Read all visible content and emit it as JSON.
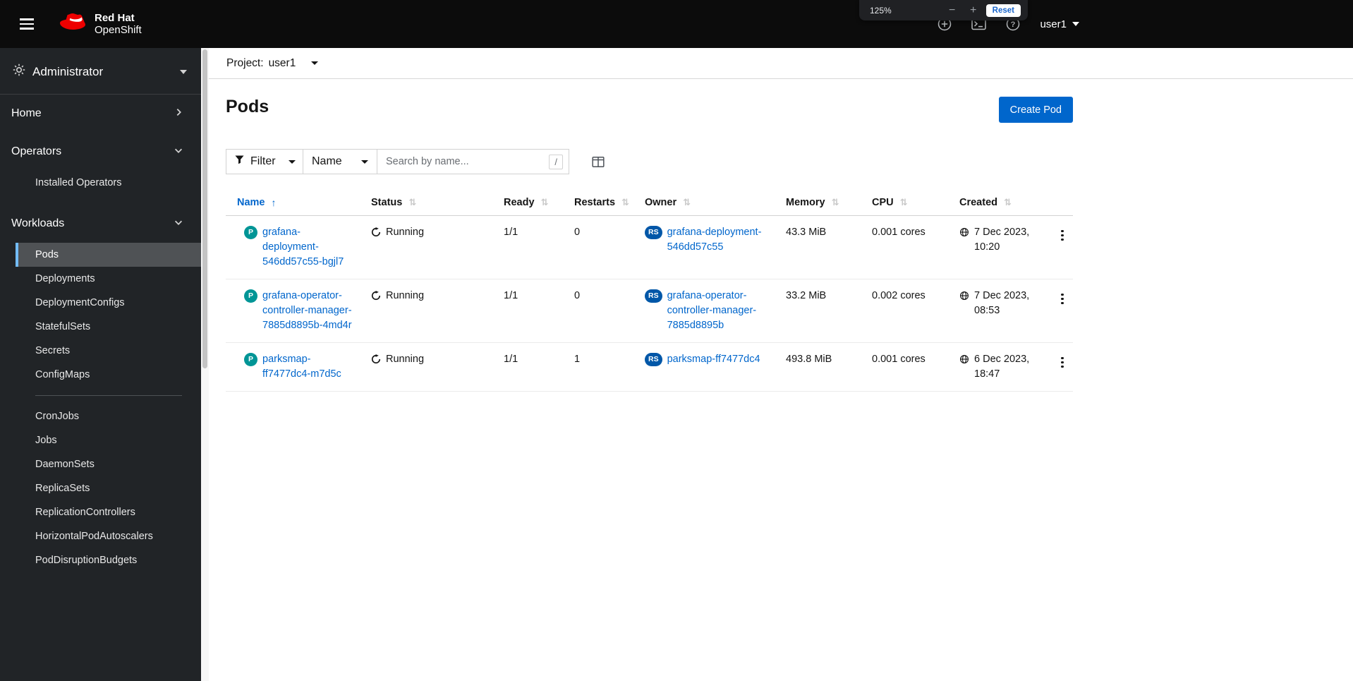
{
  "masthead": {
    "brand_line1": "Red Hat",
    "brand_line2": "OpenShift",
    "user": "user1",
    "zoom": {
      "level": "125%",
      "minus": "−",
      "plus": "+",
      "reset": "Reset"
    }
  },
  "sidebar": {
    "perspective": "Administrator",
    "sections": {
      "home": "Home",
      "operators": "Operators",
      "workloads": "Workloads"
    },
    "operators_items": [
      {
        "label": "Installed Operators"
      }
    ],
    "workloads_items": [
      {
        "label": "Pods",
        "state": "current"
      },
      {
        "label": "Deployments"
      },
      {
        "label": "DeploymentConfigs"
      },
      {
        "label": "StatefulSets"
      },
      {
        "label": "Secrets"
      },
      {
        "label": "ConfigMaps"
      },
      {
        "divider": true
      },
      {
        "label": "CronJobs"
      },
      {
        "label": "Jobs"
      },
      {
        "label": "DaemonSets"
      },
      {
        "label": "ReplicaSets"
      },
      {
        "label": "ReplicationControllers"
      },
      {
        "label": "HorizontalPodAutoscalers"
      },
      {
        "label": "PodDisruptionBudgets"
      }
    ]
  },
  "project_bar": {
    "label": "Project:",
    "value": "user1"
  },
  "page": {
    "title": "Pods",
    "create_button": "Create Pod"
  },
  "toolbar": {
    "filter_label": "Filter",
    "attribute": "Name",
    "search_placeholder": "Search by name...",
    "shortcut_hint": "/"
  },
  "table": {
    "columns": [
      {
        "label": "Name",
        "sort_icon": "↑",
        "state": "sorted"
      },
      {
        "label": "Status",
        "sort_icon": "⇅"
      },
      {
        "label": "Ready",
        "sort_icon": "⇅"
      },
      {
        "label": "Restarts",
        "sort_icon": "⇅"
      },
      {
        "label": "Owner",
        "sort_icon": "⇅"
      },
      {
        "label": "Memory",
        "sort_icon": "⇅"
      },
      {
        "label": "CPU",
        "sort_icon": "⇅"
      },
      {
        "label": "Created",
        "sort_icon": "⇅"
      }
    ],
    "rows": [
      {
        "badge": "P",
        "name": "grafana-deployment-546dd57c55-bgjl7",
        "status": "Running",
        "ready": "1/1",
        "restarts": "0",
        "owner_badge": "RS",
        "owner": "grafana-deployment-546dd57c55",
        "memory": "43.3 MiB",
        "cpu": "0.001 cores",
        "created": "7 Dec 2023, 10:20"
      },
      {
        "badge": "P",
        "name": "grafana-operator-controller-manager-7885d8895b-4md4r",
        "status": "Running",
        "ready": "1/1",
        "restarts": "0",
        "owner_badge": "RS",
        "owner": "grafana-operator-controller-manager-7885d8895b",
        "memory": "33.2 MiB",
        "cpu": "0.002 cores",
        "created": "7 Dec 2023, 08:53"
      },
      {
        "badge": "P",
        "name": "parksmap-ff7477dc4-m7d5c",
        "status": "Running",
        "ready": "1/1",
        "restarts": "1",
        "owner_badge": "RS",
        "owner": "parksmap-ff7477dc4",
        "memory": "493.8 MiB",
        "cpu": "0.001 cores",
        "created": "6 Dec 2023, 18:47"
      }
    ]
  },
  "colors": {
    "primary_blue": "#0066cc",
    "pod_badge": "#009596",
    "replicaset_badge": "#0057a8",
    "masthead_bg": "#0c0c0c",
    "sidebar_bg": "#212427",
    "selected_nav_bar": "#73bcf7"
  }
}
